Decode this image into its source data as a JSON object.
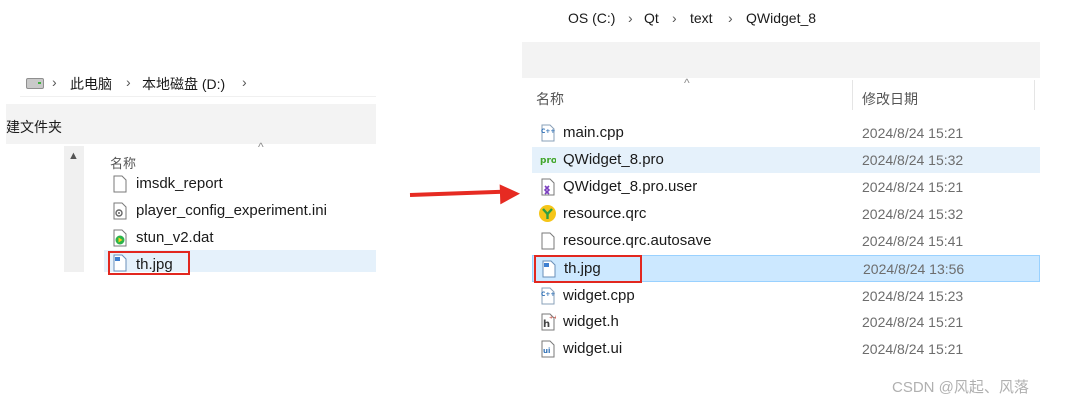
{
  "left_explorer": {
    "breadcrumb": [
      "此电脑",
      "本地磁盘 (D:)"
    ],
    "toolbar_label": "建文件夹",
    "column_name": "名称",
    "files": [
      {
        "name": "imsdk_report",
        "icon": "blank-file-icon"
      },
      {
        "name": "player_config_experiment.ini",
        "icon": "config-file-icon"
      },
      {
        "name": "stun_v2.dat",
        "icon": "media-file-icon"
      },
      {
        "name": "th.jpg",
        "icon": "image-file-icon",
        "selected": true
      }
    ]
  },
  "right_explorer": {
    "breadcrumb": [
      "OS (C:)",
      "Qt",
      "text",
      "QWidget_8"
    ],
    "column_name": "名称",
    "column_date": "修改日期",
    "files": [
      {
        "name": "main.cpp",
        "date": "2024/8/24 15:21",
        "icon": "cpp-file-icon"
      },
      {
        "name": "QWidget_8.pro",
        "date": "2024/8/24 15:32",
        "icon": "qt-pro-file-icon",
        "hover": true
      },
      {
        "name": "QWidget_8.pro.user",
        "date": "2024/8/24 15:21",
        "icon": "visual-studio-file-icon"
      },
      {
        "name": "resource.qrc",
        "date": "2024/8/24 15:32",
        "icon": "qrc-file-icon"
      },
      {
        "name": "resource.qrc.autosave",
        "date": "2024/8/24 15:41",
        "icon": "blank-file-icon"
      },
      {
        "name": "th.jpg",
        "date": "2024/8/24 13:56",
        "icon": "image-file-icon",
        "selected": true
      },
      {
        "name": "widget.cpp",
        "date": "2024/8/24 15:23",
        "icon": "cpp-file-icon"
      },
      {
        "name": "widget.h",
        "date": "2024/8/24 15:21",
        "icon": "header-file-icon"
      },
      {
        "name": "widget.ui",
        "date": "2024/8/24 15:21",
        "icon": "ui-file-icon"
      }
    ]
  },
  "watermark": "CSDN @风起、风落",
  "colors": {
    "highlight_red": "#e2271f",
    "selection_blue": "#cce8ff",
    "hover_blue": "#e5f1fb"
  }
}
